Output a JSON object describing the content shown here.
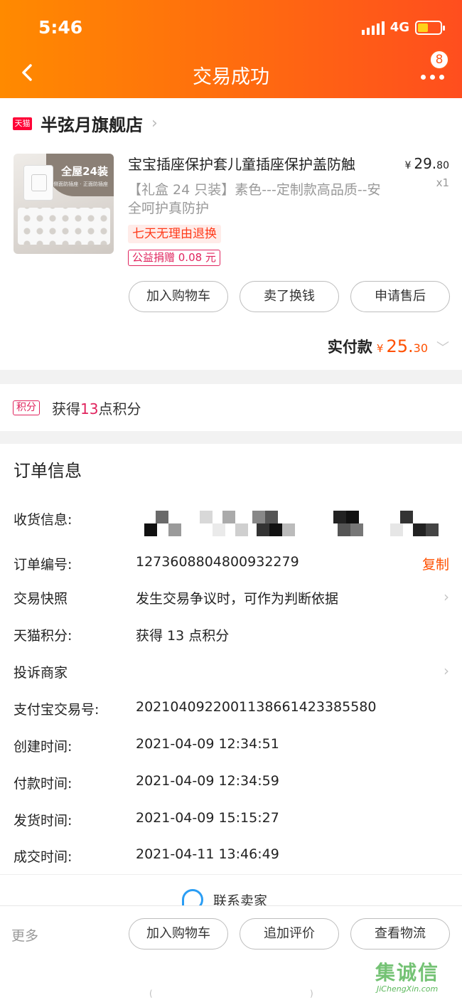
{
  "status_bar": {
    "time": "5:46",
    "network": "4G"
  },
  "header": {
    "title": "交易成功",
    "badge_count": "8"
  },
  "store": {
    "logo_text": "天猫",
    "name": "半弦月旗舰店"
  },
  "product": {
    "title": "宝宝插座保护套儿童插座保护盖防触",
    "spec": "【礼盒 24 只装】素色---定制款高品质--安全呵护真防护",
    "image_text": "全屋24装",
    "image_subtext": "侧面防插座 · 正面防插座",
    "price_currency": "¥",
    "price_int": "29.",
    "price_dec": "80",
    "quantity": "x1",
    "tag_return": "七天无理由退换",
    "tag_charity": "公益捐赠 0.08 元"
  },
  "item_actions": [
    "加入购物车",
    "卖了换钱",
    "申请售后"
  ],
  "payment": {
    "label": "实付款",
    "currency": "¥",
    "amount_int": "25.",
    "amount_dec": "30"
  },
  "points": {
    "tag": "积分",
    "prefix": "获得",
    "count": "13",
    "suffix": "点积分"
  },
  "order_info": {
    "title": "订单信息",
    "shipping_label": "收货信息:",
    "order_no_label": "订单编号:",
    "order_no": "1273608804800932279",
    "copy_label": "复制",
    "snapshot_label": "交易快照",
    "snapshot_value": "发生交易争议时，可作为判断依据",
    "tmall_points_label": "天猫积分:",
    "tmall_points_value": "获得 13 点积分",
    "complain_label": "投诉商家",
    "alipay_label": "支付宝交易号:",
    "alipay_no": "2021040922001138661423385580",
    "created_label": "创建时间:",
    "created": "2021-04-09 12:34:51",
    "paid_label": "付款时间:",
    "paid": "2021-04-09 12:34:59",
    "shipped_label": "发货时间:",
    "shipped": "2021-04-09 15:15:27",
    "completed_label": "成交时间:",
    "completed": "2021-04-11 13:46:49"
  },
  "contact": {
    "label": "联系卖家"
  },
  "bottom_bar": {
    "more": "更多",
    "actions": [
      "加入购物车",
      "追加评价",
      "查看物流"
    ]
  },
  "watermark": {
    "main": "集诚信",
    "sub": "JiChengXin.com"
  },
  "colors": {
    "header_start": "#ff8a00",
    "header_end": "#ff4e1e",
    "accent": "#ff5000",
    "tmall_red": "#e0245e"
  },
  "icons": [
    "back-arrow-icon",
    "more-dots-icon",
    "tmall-logo-icon",
    "chevron-right-icon",
    "chevron-down-icon",
    "chat-icon",
    "signal-icon",
    "battery-icon"
  ]
}
